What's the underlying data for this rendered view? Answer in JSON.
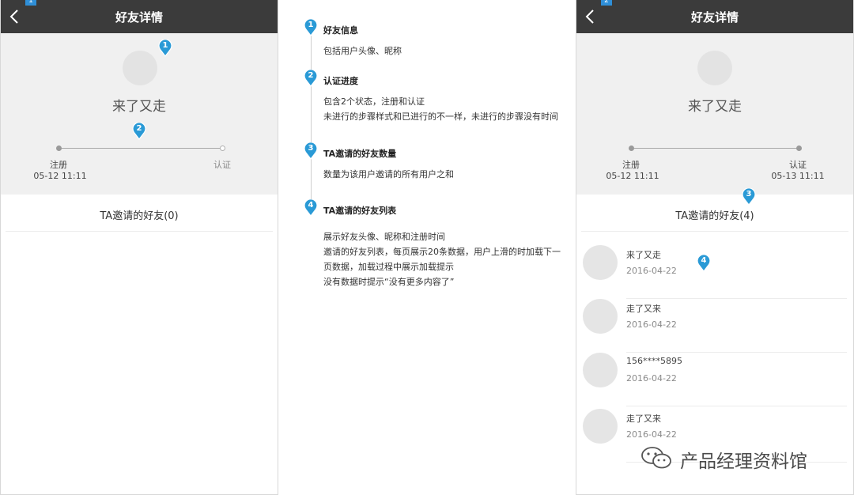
{
  "colors": {
    "nav_bg": "#3b3b3b",
    "marker": "#2a9ad6",
    "info_bg": "#f0f0f0"
  },
  "left_screen": {
    "page_tag": "1",
    "nav": {
      "title": "好友详情",
      "back_icon": "chevron-left-icon"
    },
    "nickname": "来了又走",
    "steps": [
      {
        "label": "注册",
        "time": "05-12 11:11"
      },
      {
        "label": "认证",
        "time": ""
      }
    ],
    "list_title": "TA邀请的好友(0)",
    "markers": [
      "1",
      "2"
    ]
  },
  "annotations": [
    {
      "num": "1",
      "title": "好友信息",
      "lines": [
        "包括用户头像、昵称"
      ]
    },
    {
      "num": "2",
      "title": "认证进度",
      "lines": [
        "包含2个状态，注册和认证",
        "未进行的步骤样式和已进行的不一样，未进行的步骤没有时间"
      ]
    },
    {
      "num": "3",
      "title": "TA邀请的好友数量",
      "lines": [
        "数量为该用户邀请的所有用户之和"
      ]
    },
    {
      "num": "4",
      "title": "TA邀请的好友列表",
      "lines": [
        "展示好友头像、昵称和注册时间",
        "邀请的好友列表，每页展示20条数据，用户上滑的时加载下一",
        "页数据，加载过程中展示加载提示",
        "没有数据时提示“没有更多内容了”"
      ]
    }
  ],
  "right_screen": {
    "page_tag": "2",
    "nav": {
      "title": "好友详情",
      "back_icon": "chevron-left-icon"
    },
    "nickname": "来了又走",
    "steps": [
      {
        "label": "注册",
        "time": "05-12 11:11"
      },
      {
        "label": "认证",
        "time": "05-13 11:11"
      }
    ],
    "list_title": "TA邀请的好友(4)",
    "markers": [
      "3",
      "4"
    ],
    "friends": [
      {
        "name": "来了又走",
        "date": "2016-04-22"
      },
      {
        "name": "走了又来",
        "date": "2016-04-22"
      },
      {
        "name": "156****5895",
        "date": "2016-04-22"
      },
      {
        "name": "走了又来",
        "date": "2016-04-22"
      }
    ]
  },
  "watermark": {
    "text": "产品经理资料馆",
    "icon": "wechat-icon"
  }
}
